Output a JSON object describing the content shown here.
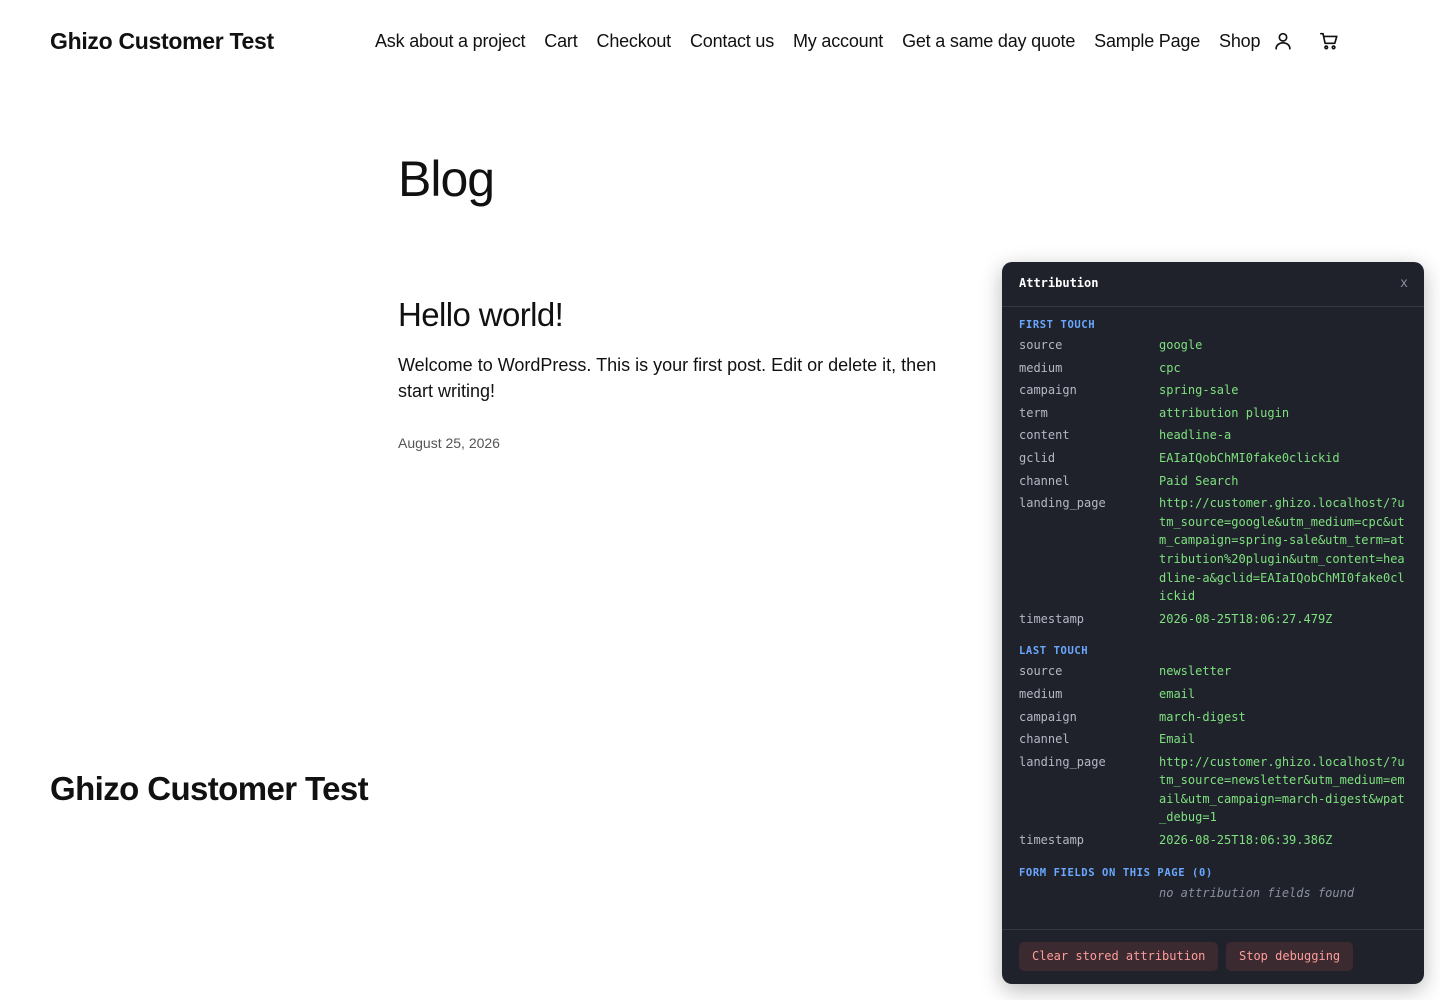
{
  "header": {
    "site_title": "Ghizo Customer Test",
    "nav": [
      "Ask about a project",
      "Cart",
      "Checkout",
      "Contact us",
      "My account",
      "Get a same day quote",
      "Sample Page",
      "Shop"
    ],
    "icons": {
      "account": "user-icon",
      "cart": "cart-icon"
    }
  },
  "main": {
    "page_title": "Blog",
    "post": {
      "title": "Hello world!",
      "excerpt": "Welcome to WordPress. This is your first post. Edit or delete it, then start writing!",
      "date": "August 25, 2026"
    }
  },
  "footer": {
    "site_title": "Ghizo Customer Test"
  },
  "debug_panel": {
    "title": "Attribution",
    "close_label": "x",
    "first_touch": {
      "heading": "FIRST TOUCH",
      "rows": [
        {
          "key": "source",
          "value": "google"
        },
        {
          "key": "medium",
          "value": "cpc"
        },
        {
          "key": "campaign",
          "value": "spring-sale"
        },
        {
          "key": "term",
          "value": "attribution plugin"
        },
        {
          "key": "content",
          "value": "headline-a"
        },
        {
          "key": "gclid",
          "value": "EAIaIQobChMI0fake0clickid"
        },
        {
          "key": "channel",
          "value": "Paid Search"
        },
        {
          "key": "landing_page",
          "value": "http://customer.ghizo.localhost/?utm_source=google&utm_medium=cpc&utm_campaign=spring-sale&utm_term=attribution%20plugin&utm_content=headline-a&gclid=EAIaIQobChMI0fake0clickid"
        },
        {
          "key": "timestamp",
          "value": "2026-08-25T18:06:27.479Z"
        }
      ]
    },
    "last_touch": {
      "heading": "LAST TOUCH",
      "rows": [
        {
          "key": "source",
          "value": "newsletter"
        },
        {
          "key": "medium",
          "value": "email"
        },
        {
          "key": "campaign",
          "value": "march-digest"
        },
        {
          "key": "channel",
          "value": "Email"
        },
        {
          "key": "landing_page",
          "value": "http://customer.ghizo.localhost/?utm_source=newsletter&utm_medium=email&utm_campaign=march-digest&wpat_debug=1"
        },
        {
          "key": "timestamp",
          "value": "2026-08-25T18:06:39.386Z"
        }
      ]
    },
    "form_fields": {
      "heading": "FORM FIELDS ON THIS PAGE (0)",
      "empty_text": "no attribution fields found"
    },
    "buttons": {
      "clear": "Clear stored attribution",
      "stop": "Stop debugging"
    },
    "colors": {
      "background": "#1f222b",
      "heading": "#6aa8ff",
      "value": "#7ee07e",
      "button_text": "#ff9c9c"
    }
  }
}
